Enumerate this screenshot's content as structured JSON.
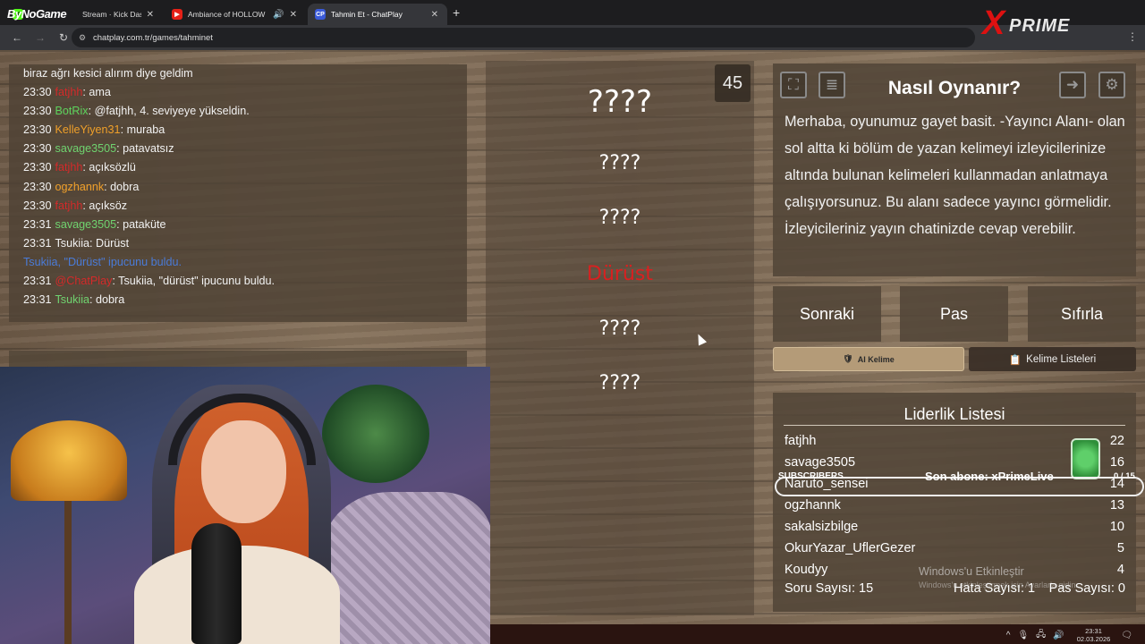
{
  "browser": {
    "tabs": [
      {
        "label": "Stream · Kick Dashboard",
        "icon": "kick-icon"
      },
      {
        "label": "Ambiance of HOLLOW KNIG",
        "icon": "youtube-icon"
      },
      {
        "label": "Tahmin Et - ChatPlay",
        "icon": "chatplay-icon",
        "favicon_text": "CP"
      }
    ],
    "logo_overlay": "ByNoGame",
    "url": "chatplay.com.tr/games/tahminet",
    "brand": {
      "x": "X",
      "name": "PRIME"
    }
  },
  "chat": {
    "lines": [
      {
        "time": "",
        "user": "",
        "user_color": "#f2f2f2",
        "sep": "",
        "text": "biraz ağrı kesici alırım diye geldim"
      },
      {
        "time": "23:30",
        "user": "fatjhh",
        "user_color": "#d42a2a",
        "sep": ":",
        "text": " ama"
      },
      {
        "time": "23:30",
        "user": "BotRix",
        "user_color": "#5dd35d",
        "sep": ":",
        "text": " @fatjhh, 4. seviyeye yükseldin."
      },
      {
        "time": "23:30",
        "user": "KelleYiyen31",
        "user_color": "#f0a02a",
        "sep": ":",
        "text": " muraba"
      },
      {
        "time": "23:30",
        "user": "savage3505",
        "user_color": "#6fd36f",
        "sep": ":",
        "text": " patavatsız"
      },
      {
        "time": "23:30",
        "user": "fatjhh",
        "user_color": "#d42a2a",
        "sep": ":",
        "text": " açıksözlü"
      },
      {
        "time": "23:30",
        "user": "ogzhannk",
        "user_color": "#f0a02a",
        "sep": ":",
        "text": " dobra"
      },
      {
        "time": "23:30",
        "user": "fatjhh",
        "user_color": "#d42a2a",
        "sep": ":",
        "text": " açıksöz"
      },
      {
        "time": "23:31",
        "user": "savage3505",
        "user_color": "#6fd36f",
        "sep": ":",
        "text": " pataküte"
      },
      {
        "time": "23:31",
        "user": "Tsukiia",
        "user_color": "#f2f2f2",
        "sep": ":",
        "text": " Dürüst"
      },
      {
        "time": "",
        "user": "Tsukiia, \"Dürüst\" ipucunu buldu.",
        "user_color": "#4a7bd8",
        "sep": "",
        "text": ""
      },
      {
        "time": "23:31",
        "user": "@ChatPlay",
        "user_color": "#d42a2a",
        "sep": ":",
        "text": " Tsukiia, \"dürüst\" ipucunu buldu."
      },
      {
        "time": "23:31",
        "user": "Tsukiia",
        "user_color": "#6fd36f",
        "sep": ":",
        "text": " dobra"
      }
    ]
  },
  "game": {
    "timer": "45",
    "main_word": "????",
    "clues": [
      "????",
      "????",
      "Dürüst",
      "????",
      "????"
    ],
    "found_color": "#d92020"
  },
  "howto": {
    "title": "Nasıl Oynanır?",
    "text": "Merhaba, oyunumuz gayet basit. -Yayıncı Alanı- olan sol altta ki bölüm de yazan kelimeyi izleyicilerinize altında bulunan kelimeleri kullanmadan anlatmaya çalışıyorsunuz. Bu alanı sadece yayıncı görmelidir. İzleyicileriniz yayın chatinizde cevap verebilir.",
    "icons": [
      "fullscreen-icon",
      "notes-icon",
      "exit-icon",
      "gear-icon"
    ]
  },
  "actions": {
    "next": "Sonraki",
    "pass": "Pas",
    "reset": "Sıfırla",
    "ai_word": "AI Kelime",
    "word_lists": "Kelime Listeleri"
  },
  "leaderboard": {
    "title": "Liderlik Listesi",
    "rows": [
      {
        "name": "fatjhh",
        "score": "22"
      },
      {
        "name": "savage3505",
        "score": "16"
      },
      {
        "name": "Naruto_sensei",
        "score": "14"
      },
      {
        "name": "ogzhannk",
        "score": "13"
      },
      {
        "name": "sakalsizbilge",
        "score": "10"
      },
      {
        "name": "OkurYazar_UflerGezer",
        "score": "5"
      },
      {
        "name": "Koudyy",
        "score": "4"
      }
    ],
    "questions": "Soru Sayısı: 15",
    "errors": "Hata Sayısı: 1",
    "passes": "Pas Sayısı: 0"
  },
  "overlay": {
    "subs_label": "SUBSCRIBERS",
    "last_sub": "Son abone: xPrimeLive",
    "sub_count": "0 / 15",
    "watermark_title": "Windows'u Etkinleştir",
    "watermark_sub": "Windows'u etkinleştirmek için Ayarlar'a gidin."
  },
  "taskbar": {
    "time": "23:31",
    "date": "02.03.2026"
  }
}
